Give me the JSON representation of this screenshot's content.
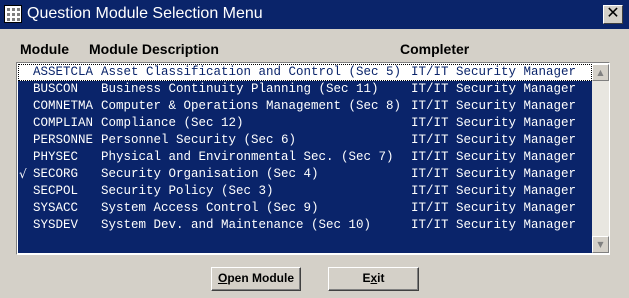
{
  "window": {
    "title": "Question Module Selection Menu",
    "close_glyph": "✕"
  },
  "headers": {
    "module": "Module",
    "description": "Module Description",
    "completer": "Completer"
  },
  "rows": [
    {
      "check": "",
      "module": "ASSETCLA",
      "description": "Asset Classification and Control (Sec 5)",
      "completer": "IT/IT Security Manager",
      "selected": true
    },
    {
      "check": "",
      "module": "BUSCON",
      "description": "Business Continuity Planning (Sec 11)",
      "completer": "IT/IT Security Manager",
      "selected": false
    },
    {
      "check": "",
      "module": "COMNETMA",
      "description": "Computer & Operations Management (Sec 8)",
      "completer": "IT/IT Security Manager",
      "selected": false
    },
    {
      "check": "",
      "module": "COMPLIAN",
      "description": "Compliance (Sec 12)",
      "completer": "IT/IT Security Manager",
      "selected": false
    },
    {
      "check": "",
      "module": "PERSONNE",
      "description": "Personnel Security (Sec 6)",
      "completer": "IT/IT Security Manager",
      "selected": false
    },
    {
      "check": "",
      "module": "PHYSEC",
      "description": "Physical and Environmental Sec. (Sec 7)",
      "completer": "IT/IT Security Manager",
      "selected": false
    },
    {
      "check": "√",
      "module": "SECORG",
      "description": "Security Organisation (Sec 4)",
      "completer": "IT/IT Security Manager",
      "selected": false
    },
    {
      "check": "",
      "module": "SECPOL",
      "description": "Security Policy (Sec 3)",
      "completer": "IT/IT Security Manager",
      "selected": false
    },
    {
      "check": "",
      "module": "SYSACC",
      "description": "System Access Control (Sec 9)",
      "completer": "IT/IT Security Manager",
      "selected": false
    },
    {
      "check": "",
      "module": "SYSDEV",
      "description": "System Dev. and Maintenance (Sec 10)",
      "completer": "IT/IT Security Manager",
      "selected": false
    }
  ],
  "scrollbar": {
    "up_icon": "▲",
    "down_icon": "▼"
  },
  "buttons": {
    "open_module": {
      "mnemonic": "O",
      "rest": "pen Module"
    },
    "exit": {
      "mnemonic": "x",
      "pre": "E",
      "rest": "it"
    }
  },
  "colors": {
    "title_bar": "#0a246a",
    "list_background": "#0a246a",
    "window": "#d4d0c8"
  }
}
